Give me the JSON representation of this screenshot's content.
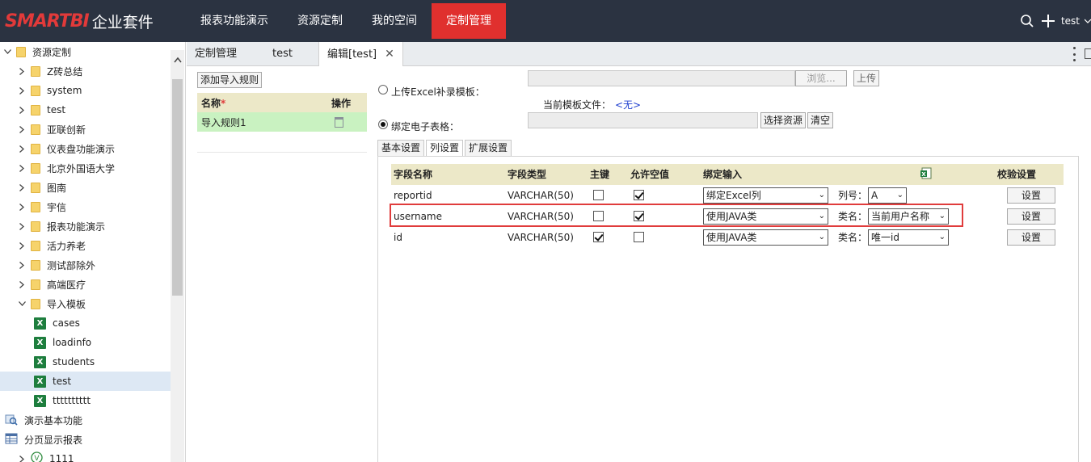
{
  "header": {
    "logo_brand": "SMARTBI",
    "logo_suffix": "企业套件",
    "nav": [
      {
        "label": "报表功能演示"
      },
      {
        "label": "资源定制"
      },
      {
        "label": "我的空间"
      },
      {
        "label": "定制管理"
      }
    ],
    "user": "test"
  },
  "tree": {
    "items": [
      {
        "label": "资源定制",
        "type": "folder",
        "caret": "down"
      },
      {
        "label": "Z砖总结",
        "type": "folder",
        "caret": "right"
      },
      {
        "label": "system",
        "type": "folder",
        "caret": "right"
      },
      {
        "label": "test",
        "type": "folder",
        "caret": "right"
      },
      {
        "label": "亚联创新",
        "type": "folder",
        "caret": "right"
      },
      {
        "label": "仪表盘功能演示",
        "type": "folder",
        "caret": "right"
      },
      {
        "label": "北京外国语大学",
        "type": "folder",
        "caret": "right"
      },
      {
        "label": "图南",
        "type": "folder",
        "caret": "right"
      },
      {
        "label": "宇信",
        "type": "folder",
        "caret": "right"
      },
      {
        "label": "报表功能演示",
        "type": "folder",
        "caret": "right"
      },
      {
        "label": "活力养老",
        "type": "folder",
        "caret": "right"
      },
      {
        "label": "测试部除外",
        "type": "folder",
        "caret": "right"
      },
      {
        "label": "高端医疗",
        "type": "folder",
        "caret": "right"
      },
      {
        "label": "导入模板",
        "type": "folder",
        "caret": "down"
      },
      {
        "label": "cases",
        "type": "excel"
      },
      {
        "label": "loadinfo",
        "type": "excel"
      },
      {
        "label": "students",
        "type": "excel"
      },
      {
        "label": "test",
        "type": "excel"
      },
      {
        "label": "tttttttttt",
        "type": "excel"
      },
      {
        "label": "演示基本功能",
        "type": "query"
      },
      {
        "label": "分页显示报表",
        "type": "report"
      },
      {
        "label": "1111",
        "type": "v"
      }
    ]
  },
  "tabs": {
    "items": [
      {
        "label": "定制管理"
      },
      {
        "label": "test"
      },
      {
        "label": "编辑[test]"
      }
    ]
  },
  "rules": {
    "add_button": "添加导入规则",
    "col_name": "名称",
    "required_mark": "*",
    "col_action": "操作",
    "rows": [
      {
        "name": "导入规则1"
      }
    ]
  },
  "upload": {
    "upload_label": "上传Excel补录模板：",
    "browse_button": "浏览...",
    "upload_button": "上传",
    "current_file_label": "当前模板文件：",
    "current_file_value": "<无>",
    "bind_label": "绑定电子表格：",
    "select_resource_button": "选择资源",
    "clear_button": "清空"
  },
  "subtabs": {
    "items": [
      {
        "label": "基本设置"
      },
      {
        "label": "列设置"
      },
      {
        "label": "扩展设置"
      }
    ]
  },
  "columns": {
    "headers": {
      "field_name": "字段名称",
      "field_type": "字段类型",
      "primary_key": "主键",
      "nullable": "允许空值",
      "bind_input": "绑定输入",
      "validation": "校验设置"
    },
    "rows": [
      {
        "name": "reportid",
        "type": "VARCHAR(50)",
        "pk": false,
        "nullable": true,
        "bind": "绑定Excel列",
        "extra_label": "列号：",
        "extra_value": "A",
        "set_button": "设置"
      },
      {
        "name": "username",
        "type": "VARCHAR(50)",
        "pk": false,
        "nullable": true,
        "bind": "使用JAVA类",
        "extra_label": "类名：",
        "extra_value": "当前用户名称",
        "set_button": "设置"
      },
      {
        "name": "id",
        "type": "VARCHAR(50)",
        "pk": true,
        "nullable": false,
        "bind": "使用JAVA类",
        "extra_label": "类名：",
        "extra_value": "唯一id",
        "set_button": "设置"
      }
    ]
  },
  "colors": {
    "topbar": "#2b3341",
    "accent_red": "#e0302e",
    "header_row": "#ece8c8",
    "selected_rule": "#c9f2c1",
    "highlight": "#e03c3c"
  }
}
